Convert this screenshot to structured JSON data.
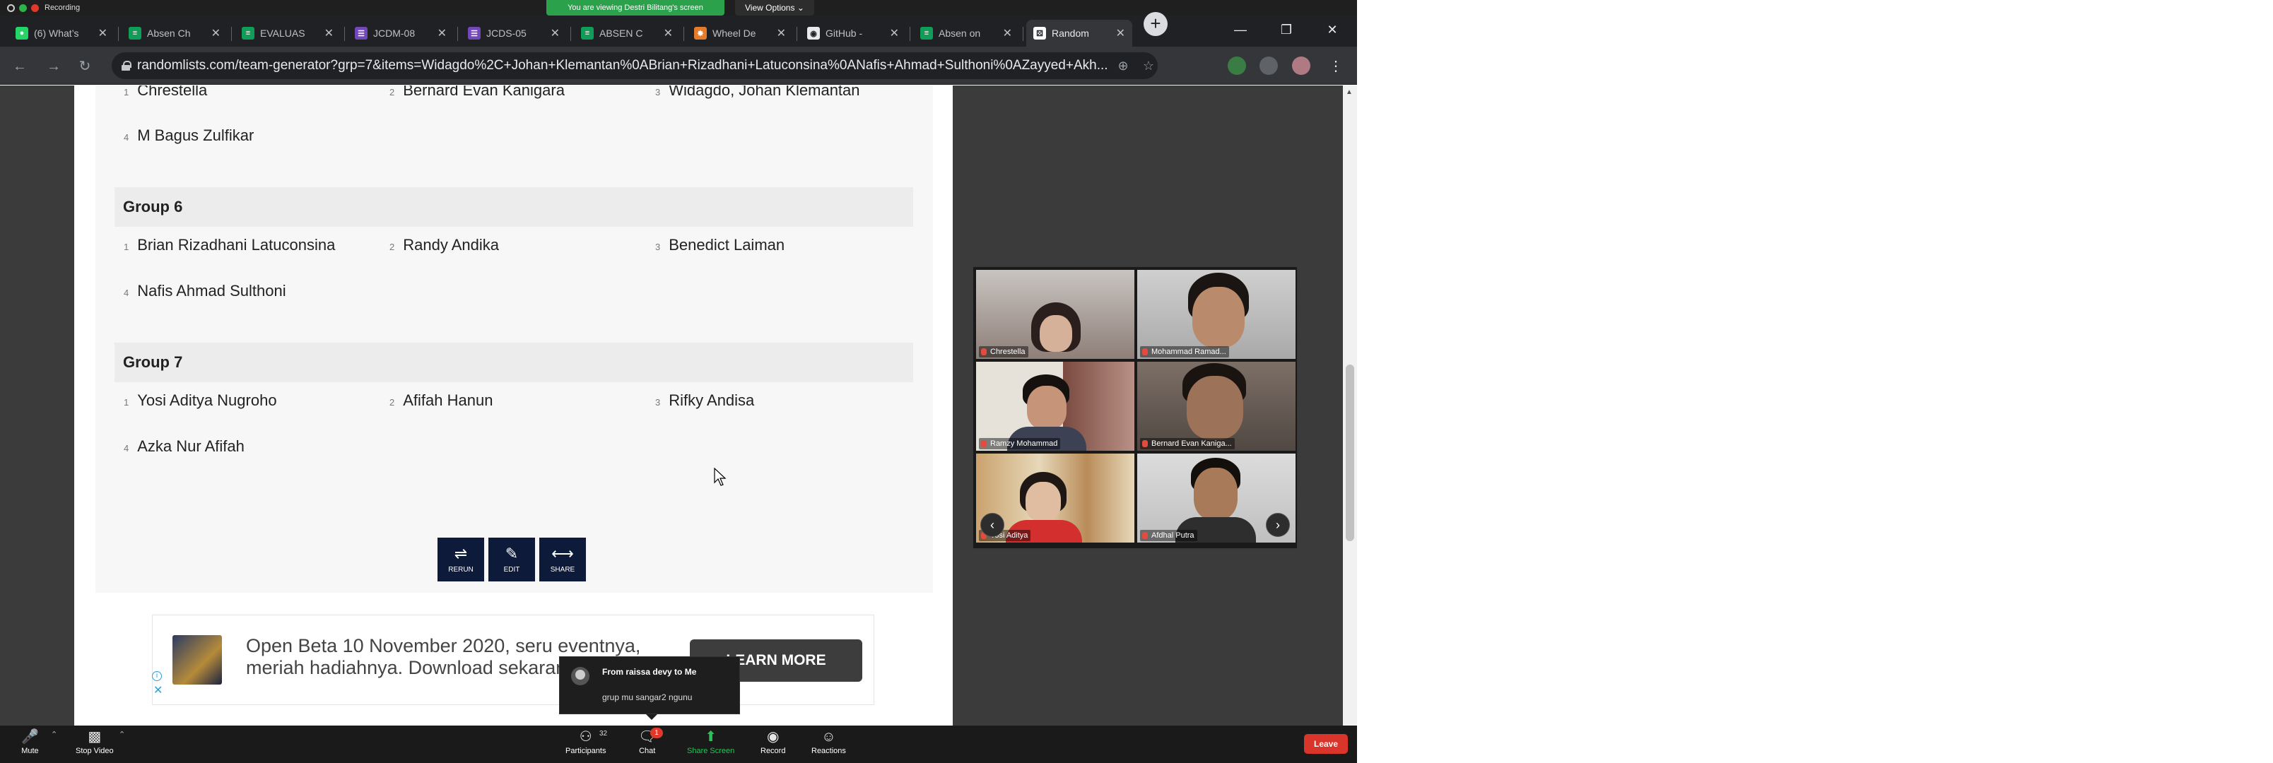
{
  "zoom_banner": {
    "recording_text": "Recording",
    "viewing_text": "You are viewing Destri Bilitang's screen",
    "view_options": "View Options ⌄"
  },
  "tabs": [
    {
      "title": "(6) What’s",
      "favicon": "whatsapp-icon",
      "color": "#25d366"
    },
    {
      "title": "Absen Ch",
      "favicon": "sheets-icon",
      "color": "#0f9d58"
    },
    {
      "title": "EVALUAS",
      "favicon": "sheets-icon",
      "color": "#0f9d58"
    },
    {
      "title": "JCDM-08",
      "favicon": "forms-icon",
      "color": "#7248b9"
    },
    {
      "title": "JCDS-05",
      "favicon": "forms-icon",
      "color": "#7248b9"
    },
    {
      "title": "ABSEN C",
      "favicon": "sheets-icon",
      "color": "#0f9d58"
    },
    {
      "title": "Wheel De",
      "favicon": "wheel-icon",
      "color": "#e57c2b"
    },
    {
      "title": "GitHub -",
      "favicon": "github-icon",
      "color": "#e8eaed"
    },
    {
      "title": "Absen on",
      "favicon": "sheets-icon",
      "color": "#0f9d58"
    },
    {
      "title": "Random",
      "favicon": "dice-icon",
      "color": "#ffffff"
    }
  ],
  "address_bar": {
    "url": "randomlists.com/team-generator?grp=7&items=Widagdo%2C+Johan+Klemantan%0ABrian+Rizadhani+Latuconsina%0ANafis+Ahmad+Sulthoni%0AZayyed+Akh..."
  },
  "groups_page": {
    "partial_group_members": [
      {
        "num": "1",
        "name": "Chrestella"
      },
      {
        "num": "2",
        "name": "Bernard Evan Kanigara"
      },
      {
        "num": "3",
        "name": "Widagdo, Johan Klemantan"
      },
      {
        "num": "4",
        "name": "M Bagus Zulfikar"
      }
    ],
    "group6": {
      "title": "Group 6",
      "members": [
        {
          "num": "1",
          "name": "Brian Rizadhani Latuconsina"
        },
        {
          "num": "2",
          "name": "Randy Andika"
        },
        {
          "num": "3",
          "name": "Benedict Laiman"
        },
        {
          "num": "4",
          "name": "Nafis Ahmad Sulthoni"
        }
      ]
    },
    "group7": {
      "title": "Group 7",
      "members": [
        {
          "num": "1",
          "name": "Yosi Aditya Nugroho"
        },
        {
          "num": "2",
          "name": "Afifah Hanun"
        },
        {
          "num": "3",
          "name": "Rifky Andisa"
        },
        {
          "num": "4",
          "name": "Azka Nur Afifah"
        }
      ]
    },
    "buttons": {
      "rerun": "RERUN",
      "edit": "EDIT",
      "share": "SHARE"
    }
  },
  "ad": {
    "text": "Open Beta 10 November 2020, seru eventnya, meriah hadiahnya. Download sekarang",
    "button": "LEARN MORE"
  },
  "chat_notification": {
    "from": "From raissa devy to Me",
    "message": "grup mu sangar2 ngunu"
  },
  "gallery": {
    "participants": [
      {
        "name": "Chrestella"
      },
      {
        "name": "Mohammad Ramad..."
      },
      {
        "name": "Ramzy Mohammad"
      },
      {
        "name": "Bernard Evan Kaniga..."
      },
      {
        "name": "Yosi Aditya"
      },
      {
        "name": "Afdhal Putra"
      }
    ]
  },
  "zoom_toolbar": {
    "mute": "Mute",
    "stop_video": "Stop Video",
    "participants": "Participants",
    "participant_count": "32",
    "chat": "Chat",
    "chat_badge": "1",
    "share_screen": "Share Screen",
    "record": "Record",
    "reactions": "Reactions",
    "leave": "Leave"
  }
}
